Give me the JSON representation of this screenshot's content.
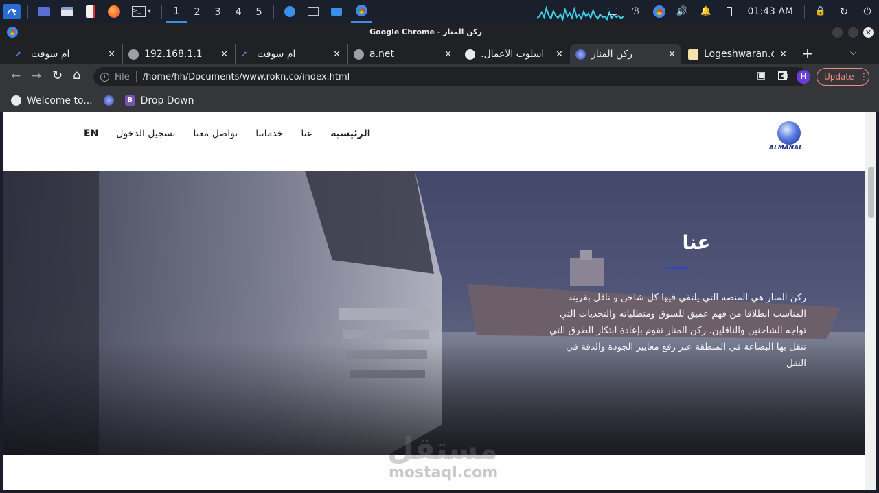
{
  "taskbar": {
    "workspaces": [
      "1",
      "2",
      "3",
      "4",
      "5"
    ],
    "clock": "01:43 AM",
    "icons": [
      "kali-menu-icon",
      "desktop-icon",
      "file-manager-icon",
      "text-editor-icon",
      "firefox-icon",
      "terminal-icon"
    ]
  },
  "window": {
    "title": "Google Chrome - ركن المنار"
  },
  "tabs": [
    {
      "title": "ام سوفت",
      "favicon": "soft-icon"
    },
    {
      "title": "192.168.1.1",
      "favicon": "globe-icon"
    },
    {
      "title": "ام سوفت",
      "favicon": "soft-icon"
    },
    {
      "title": "a.net",
      "favicon": "globe-icon"
    },
    {
      "title": "أسلوب الأعمال.",
      "favicon": "globe-icon"
    },
    {
      "title": "ركن المنار",
      "favicon": "almanal-icon"
    },
    {
      "title": "Logeshwaran.c",
      "favicon": "logo-icon"
    }
  ],
  "toolbar": {
    "scheme": "File",
    "url": "/home/hh/Documents/www.rokn.co/index.html",
    "profile_initial": "H",
    "update_label": "Update"
  },
  "bookmarks": [
    {
      "label": "Welcome to...",
      "icon": "globe-icon"
    },
    {
      "label": "",
      "icon": "almanal-icon"
    },
    {
      "label": "Drop Down",
      "icon": "bootstrap-icon",
      "badge": "B"
    }
  ],
  "site": {
    "logo_text": "ALMANAL",
    "nav": [
      "الرئيسية",
      "عنا",
      "خدماتنا",
      "تواصل معنا",
      "تسجيل الدخول",
      "EN"
    ],
    "hero": {
      "title": "عنا",
      "text": "ركن المنار هي المنصة التي يلتقي فيها كل شاحن و ناقل بقرينه المناسب انطلاقا من فهم عميق للسوق ومتطلباته والتحديات التي تواجه الشاحنين والناقلين. ركن المنار تقوم بإعادة ابتكار الطرق التي تنقل بها البضاعة في المنطقة عبر رفع معايير الجودة والدقة في النقل"
    }
  },
  "watermark": {
    "arabic": "مستقل",
    "latin": "mostaql.com"
  },
  "colors": {
    "accent": "#3146c8",
    "update_border": "#f28b82",
    "chrome_dark": "#202124",
    "toolbar": "#35363a"
  }
}
